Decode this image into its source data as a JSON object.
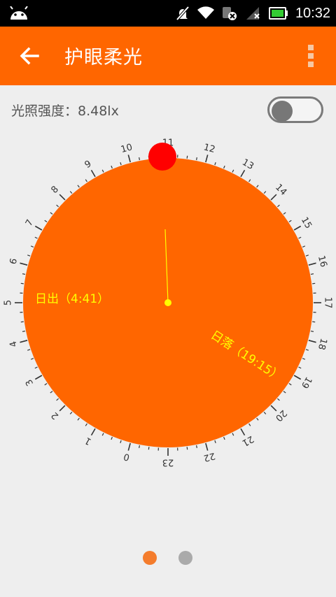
{
  "status_bar": {
    "time": "10:32",
    "icons": [
      "android-icon",
      "mute-icon",
      "wifi-icon",
      "data-icon",
      "signal-icon",
      "battery-icon"
    ]
  },
  "app_bar": {
    "title": "护眼柔光",
    "back_icon": "arrow-left-icon",
    "menu_icon": "overflow-menu-icon",
    "color": "#ff6600"
  },
  "light": {
    "label": "光照强度：8.48lx",
    "toggle_on": false
  },
  "dial": {
    "hour_labels": [
      "0",
      "1",
      "2",
      "3",
      "4",
      "5",
      "6",
      "7",
      "8",
      "9",
      "10",
      "11",
      "12",
      "13",
      "14",
      "15",
      "16",
      "17",
      "18",
      "19",
      "20",
      "21",
      "22",
      "23"
    ],
    "sunrise_label": "日出（4:41）",
    "sunset_label": "日落（19:15）",
    "sunrise_time": "4:41",
    "sunset_time": "19:15",
    "current_time": "10:32",
    "disc_color": "#ff6600",
    "marker_color": "#ff0000",
    "hand_color": "#ffff00"
  },
  "pager": {
    "count": 2,
    "active_index": 0,
    "active_color": "#f47c2c",
    "inactive_color": "#aaaaaa"
  }
}
